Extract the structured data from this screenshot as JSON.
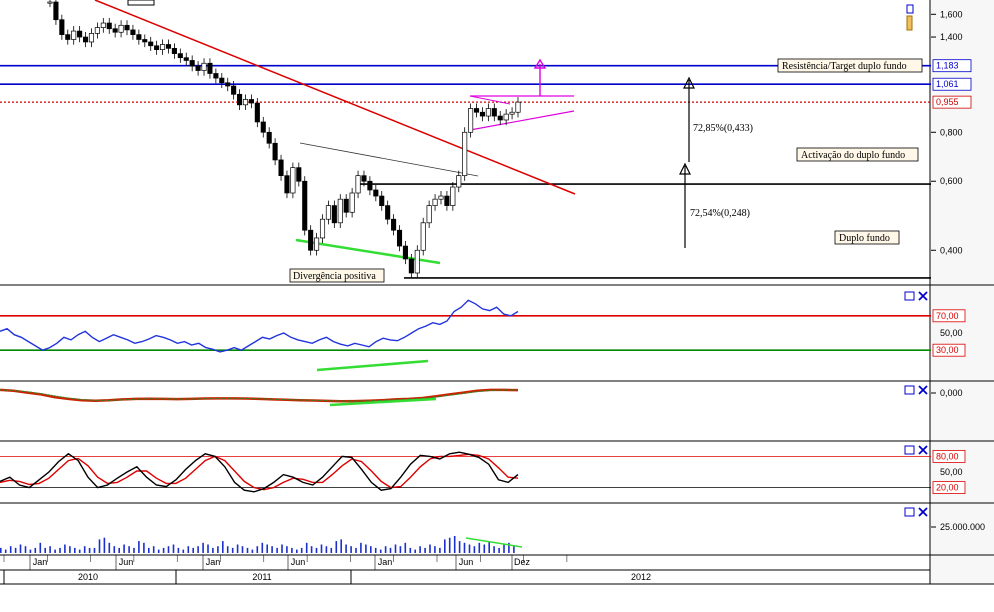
{
  "chart_data": {
    "type": "candlestick-with-indicators",
    "date_axis": {
      "months": [
        "Jan",
        "Jun",
        "Jan",
        "Jun",
        "Jan",
        "Jun",
        "Dez"
      ],
      "years": [
        "2010",
        "2011",
        "2012"
      ]
    },
    "price_panel": {
      "scale": "log",
      "ylim": [
        0.33,
        1.72
      ],
      "ticks": [
        {
          "v": 1.6,
          "label": "1,600"
        },
        {
          "v": 1.4,
          "label": "1,400"
        },
        {
          "v": 0.8,
          "label": "0,800"
        },
        {
          "v": 0.6,
          "label": "0,600"
        },
        {
          "v": 0.4,
          "label": "0,400"
        }
      ],
      "levels": [
        {
          "v": 1.183,
          "label": "1,183",
          "color": "#0000cc",
          "style": "solid"
        },
        {
          "v": 1.061,
          "label": "1,061",
          "color": "#0000cc",
          "style": "solid"
        },
        {
          "v": 0.955,
          "label": "0,955",
          "color": "#cc0000",
          "style": "dotted"
        },
        {
          "v": 0.59,
          "label": "",
          "color": "#000000",
          "style": "solid"
        },
        {
          "v": 0.34,
          "label": "",
          "color": "#000000",
          "style": "solid"
        }
      ],
      "annotations": [
        {
          "text": "Resistência/Target duplo fundo",
          "level": 1.183
        },
        {
          "text": "Activação do duplo fundo",
          "level": 0.59
        },
        {
          "text": "Duplo fundo",
          "level": 0.34
        },
        {
          "text": "Divergência positiva",
          "level": 0.31
        },
        {
          "text": "72,85%(0,433)"
        },
        {
          "text": "72,54%(0,248)"
        }
      ],
      "close_series": [
        1.72,
        1.55,
        1.42,
        1.38,
        1.45,
        1.4,
        1.36,
        1.43,
        1.48,
        1.52,
        1.47,
        1.44,
        1.5,
        1.46,
        1.42,
        1.38,
        1.36,
        1.33,
        1.3,
        1.34,
        1.31,
        1.27,
        1.24,
        1.22,
        1.18,
        1.15,
        1.2,
        1.13,
        1.1,
        1.07,
        1.05,
        1.0,
        0.94,
        0.97,
        0.95,
        0.85,
        0.8,
        0.75,
        0.68,
        0.62,
        0.56,
        0.65,
        0.6,
        0.45,
        0.4,
        0.43,
        0.48,
        0.52,
        0.47,
        0.54,
        0.5,
        0.56,
        0.62,
        0.6,
        0.57,
        0.55,
        0.52,
        0.48,
        0.45,
        0.41,
        0.38,
        0.35,
        0.4,
        0.47,
        0.52,
        0.54,
        0.55,
        0.52,
        0.58,
        0.62,
        0.8,
        0.92,
        0.9,
        0.88,
        0.92,
        0.88,
        0.86,
        0.89,
        0.9,
        0.955
      ]
    },
    "rsi_panel": {
      "ylim": [
        0,
        100
      ],
      "ticks": [
        {
          "v": 70,
          "label": "70,00"
        },
        {
          "v": 50,
          "label": "50,00"
        },
        {
          "v": 30,
          "label": "30,00"
        }
      ],
      "series": [
        52,
        55,
        48,
        45,
        40,
        35,
        30,
        33,
        38,
        45,
        42,
        48,
        52,
        45,
        40,
        44,
        48,
        45,
        42,
        38,
        40,
        43,
        47,
        45,
        42,
        38,
        40,
        36,
        38,
        33,
        31,
        28,
        30,
        33,
        30,
        35,
        40,
        45,
        43,
        47,
        50,
        45,
        42,
        40,
        38,
        42,
        45,
        40,
        37,
        35,
        38,
        36,
        34,
        40,
        44,
        42,
        41,
        45,
        50,
        55,
        58,
        62,
        60,
        64,
        75,
        80,
        88,
        84,
        78,
        76,
        80,
        72,
        70,
        75
      ]
    },
    "macd_panel": {
      "ylim": [
        -1,
        1
      ],
      "ticks": [
        {
          "v": 0,
          "label": "0,000"
        }
      ],
      "series": [
        0.45,
        0.4,
        0.3,
        0.2,
        0.05,
        -0.05,
        -0.12,
        -0.15,
        -0.12,
        -0.08,
        -0.05,
        -0.04,
        -0.05,
        -0.06,
        -0.05,
        -0.03,
        -0.02,
        -0.02,
        -0.03,
        -0.05,
        -0.08,
        -0.1,
        -0.12,
        -0.14,
        -0.16,
        -0.18,
        -0.17,
        -0.15,
        -0.12,
        -0.08,
        -0.05,
        0.0,
        0.1,
        0.2,
        0.3,
        0.4,
        0.45,
        0.45,
        0.44
      ]
    },
    "stoch_panel": {
      "ylim": [
        0,
        100
      ],
      "ticks": [
        {
          "v": 80,
          "label": "80,00"
        },
        {
          "v": 50,
          "label": "50,00"
        },
        {
          "v": 20,
          "label": "20,00"
        }
      ],
      "k": [
        32,
        40,
        25,
        20,
        35,
        50,
        70,
        85,
        72,
        40,
        20,
        25,
        38,
        50,
        60,
        40,
        25,
        22,
        35,
        55,
        72,
        85,
        80,
        60,
        30,
        15,
        12,
        18,
        30,
        45,
        40,
        30,
        25,
        40,
        60,
        80,
        78,
        55,
        30,
        15,
        18,
        40,
        65,
        82,
        80,
        75,
        85,
        88,
        84,
        78,
        65,
        35,
        30,
        45
      ],
      "d": [
        30,
        34,
        32,
        26,
        28,
        38,
        55,
        72,
        76,
        62,
        40,
        28,
        30,
        40,
        52,
        52,
        38,
        28,
        28,
        38,
        55,
        72,
        80,
        72,
        52,
        32,
        20,
        16,
        20,
        30,
        38,
        36,
        30,
        30,
        45,
        62,
        75,
        70,
        52,
        32,
        20,
        22,
        40,
        60,
        75,
        80,
        80,
        82,
        84,
        82,
        75,
        58,
        40,
        38
      ]
    },
    "volume_panel": {
      "ticks": [
        {
          "v": 25000000,
          "label": "25.000.000"
        }
      ],
      "values": [
        3,
        2,
        4,
        3,
        5,
        4,
        2,
        3,
        6,
        3,
        4,
        2,
        3,
        5,
        4,
        3,
        2,
        4,
        3,
        3,
        8,
        9,
        6,
        4,
        3,
        5,
        4,
        3,
        7,
        6,
        3,
        4,
        2,
        3,
        4,
        5,
        3,
        2,
        4,
        3,
        4,
        6,
        5,
        3,
        4,
        7,
        4,
        3,
        5,
        4,
        3,
        2,
        4,
        6,
        5,
        4,
        3,
        5,
        4,
        3,
        2,
        3,
        6,
        4,
        3,
        5,
        4,
        3,
        7,
        8,
        5,
        4,
        3,
        6,
        5,
        4,
        3,
        2,
        4,
        3,
        5,
        4,
        6,
        3,
        2,
        4,
        3,
        5,
        4,
        3,
        8,
        9,
        10,
        7,
        6,
        5,
        4,
        6,
        5,
        7,
        4,
        3,
        5,
        6,
        4
      ]
    }
  }
}
